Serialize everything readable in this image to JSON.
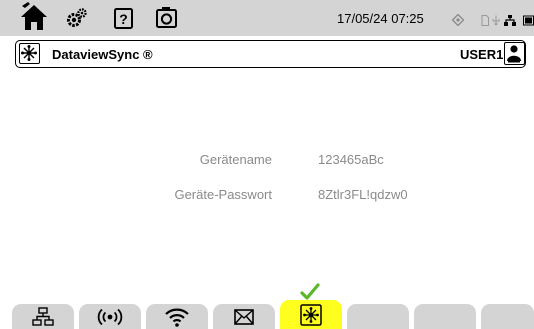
{
  "topbar": {
    "datetime": "17/05/24 07:25"
  },
  "header": {
    "title": "DataviewSync ®",
    "user": "USER1"
  },
  "form": {
    "fields": [
      {
        "label": "Gerätename",
        "value": "123465aBc"
      },
      {
        "label": "Geräte-Passwort",
        "value": "8Ztlr3FL!qdzw0"
      }
    ]
  },
  "tabs": [
    {
      "icon": "ethernet-icon",
      "active": false
    },
    {
      "icon": "wireless-broadcast-icon",
      "active": false
    },
    {
      "icon": "wifi-icon",
      "active": false
    },
    {
      "icon": "email-icon",
      "active": false
    },
    {
      "icon": "dataviewsync-icon",
      "active": true
    },
    {
      "icon": "",
      "active": false
    },
    {
      "icon": "",
      "active": false
    },
    {
      "icon": "",
      "active": false
    }
  ],
  "colors": {
    "bar": "#d4d4d4",
    "active_tab": "#ffff1f",
    "check": "#5ab82a",
    "label_gray": "#8a8a8a"
  }
}
